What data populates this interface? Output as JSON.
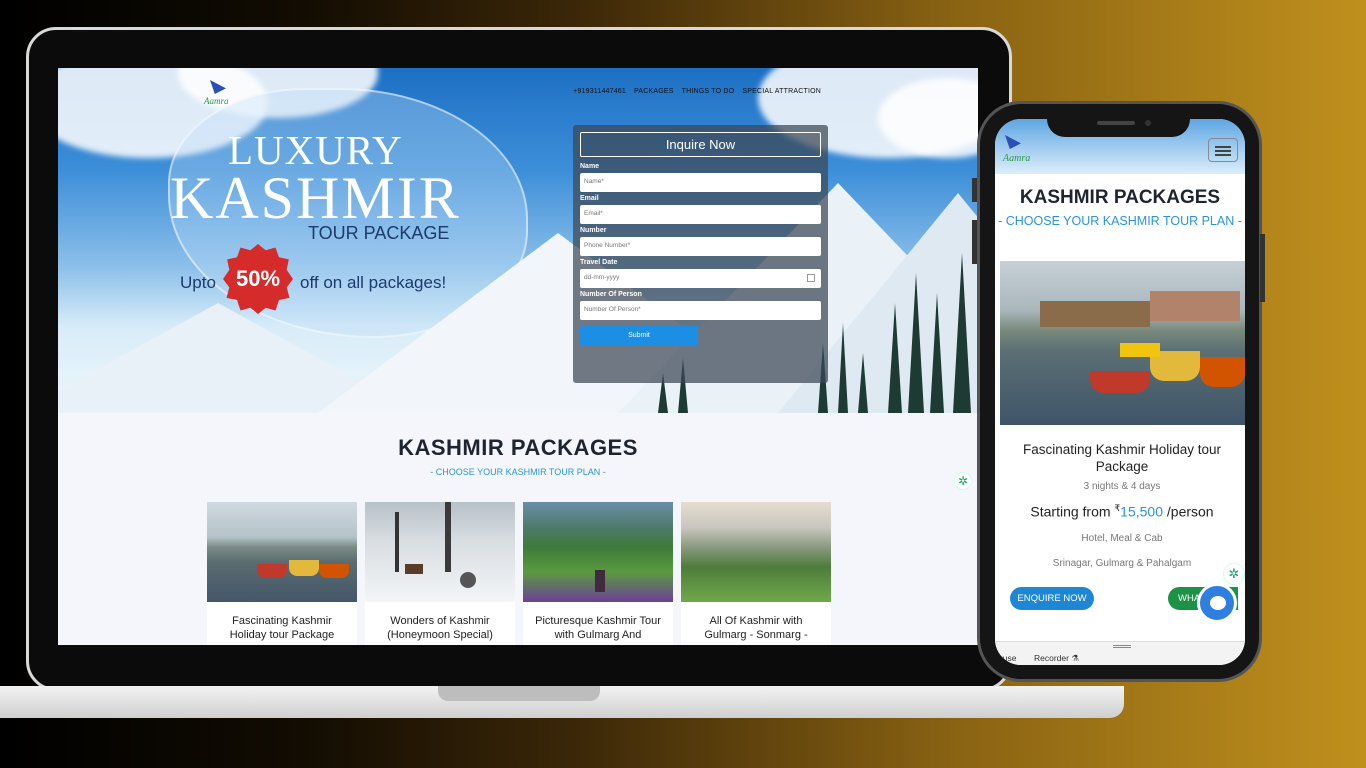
{
  "laptop": {
    "nav": {
      "phone": "+919311447461",
      "packages": "PACKAGES",
      "things": "THINGS TO DO",
      "special": "SPECIAL ATTRACTION"
    },
    "logo_text": "Aamra",
    "hero": {
      "line1": "LUXURY",
      "line2": "KASHMIR",
      "line3": "TOUR PACKAGE",
      "offer_pre": "Upto",
      "offer_badge": "50%",
      "offer_post": "off on all packages!"
    },
    "form": {
      "title": "Inquire Now",
      "name_label": "Name",
      "name_placeholder": "Name*",
      "email_label": "Email",
      "email_placeholder": "Email*",
      "number_label": "Number",
      "number_placeholder": "Phone Number*",
      "date_label": "Travel Date",
      "date_placeholder": "dd-mm-yyyy",
      "persons_label": "Number Of Person",
      "persons_placeholder": "Number Of Person*",
      "submit": "Submit"
    },
    "packages": {
      "title": "KASHMIR PACKAGES",
      "subtitle": "- CHOOSE YOUR KASHMIR TOUR PLAN -",
      "cards": [
        {
          "title": "Fascinating Kashmir Holiday tour Package"
        },
        {
          "title": "Wonders of Kashmir (Honeymoon Special)"
        },
        {
          "title": "Picturesque Kashmir Tour with Gulmarg And"
        },
        {
          "title": "All Of Kashmir with Gulmarg - Sonmarg -"
        }
      ]
    }
  },
  "phone": {
    "logo_text": "Aamra",
    "title": "KASHMIR PACKAGES",
    "subtitle": "- CHOOSE YOUR KASHMIR TOUR PLAN -",
    "card": {
      "title": "Fascinating Kashmir Holiday tour Package",
      "nights": "3 nights & 4 days",
      "price_prefix": "Starting from",
      "price_currency": "₹",
      "price_value": "15,500",
      "price_suffix": "/person",
      "includes": "Hotel, Meal & Cab",
      "route": "Srinagar, Gulmarg & Pahalgam",
      "enquire": "ENQUIRE NOW",
      "whatsapp": "WHA"
    },
    "bottom_left": "ouse",
    "bottom_right": "Recorder"
  },
  "colors": {
    "accent_blue": "#2a94d6",
    "badge_red": "#d52b2b",
    "whatsapp_green": "#1d9146"
  }
}
